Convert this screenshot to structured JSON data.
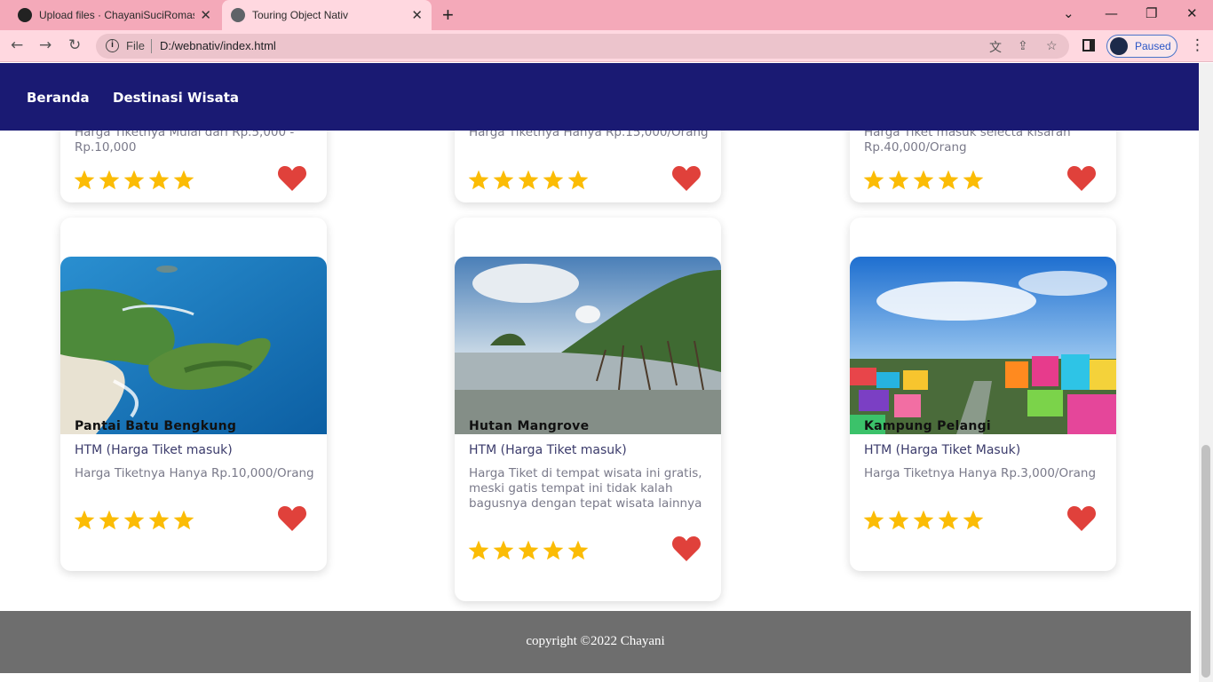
{
  "browser": {
    "tabs": [
      {
        "title": "Upload files · ChayaniSuciRomas",
        "active": false
      },
      {
        "title": "Touring Object Nativ",
        "active": true
      }
    ],
    "address": {
      "scheme_label": "File",
      "url": "D:/webnativ/index.html"
    },
    "profile_label": "Paused"
  },
  "nav": {
    "items": [
      "Beranda",
      "Destinasi Wisata"
    ]
  },
  "top_cards": [
    {
      "desc": "Harga Tiketnya Mulai dari Rp.5,000 - Rp.10,000"
    },
    {
      "desc": "Harga Tiketnya Hanya Rp.15,000/Orang"
    },
    {
      "desc": "Harga Tiket masuk selecta kisaran Rp.40,000/Orang"
    }
  ],
  "cards": [
    {
      "title": "Pantai Batu Bengkung",
      "htm": "HTM (Harga Tiket masuk)",
      "desc": "Harga Tiketnya Hanya Rp.10,000/Orang",
      "rating": 5
    },
    {
      "title": "Hutan Mangrove",
      "htm": "HTM (Harga Tiket masuk)",
      "desc": "Harga Tiket di tempat wisata ini gratis, meski gatis tempat ini tidak kalah bagusnya dengan tepat wisata lainnya",
      "rating": 5
    },
    {
      "title": "Kampung Pelangi",
      "htm": "HTM (Harga Tiket Masuk)",
      "desc": "Harga Tiketnya Hanya Rp.3,000/Orang",
      "rating": 5
    }
  ],
  "footer": {
    "text": "copyright ©2022 Chayani"
  },
  "colors": {
    "nav_bg": "#1a1a73",
    "star": "#fbbc05",
    "heart": "#e0413b",
    "footer_bg": "#6e6e6e"
  }
}
